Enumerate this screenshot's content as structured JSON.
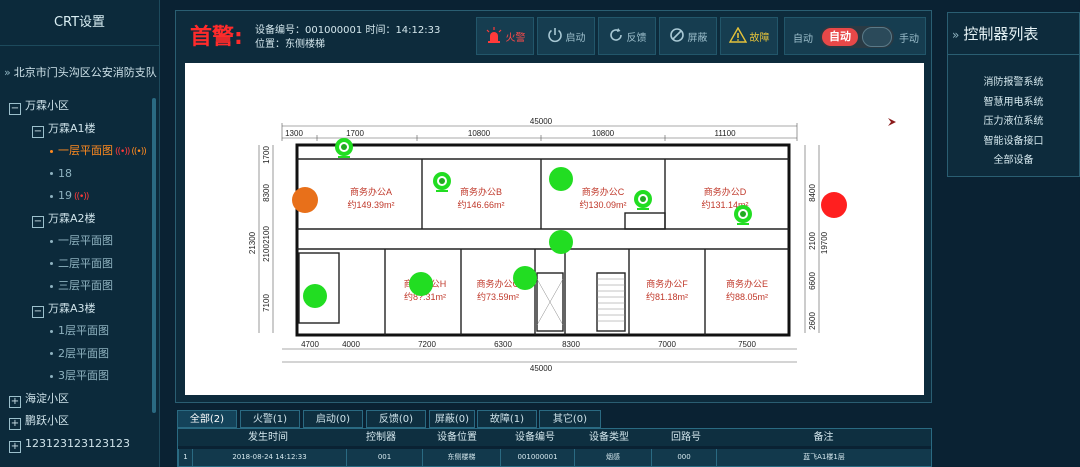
{
  "sidebar": {
    "title": "CRT设置",
    "org": "北京市门头沟区公安消防支队",
    "tree": [
      {
        "kind": "group",
        "label": "万霖小区",
        "expanded": true
      },
      {
        "kind": "group",
        "label": "万霖A1楼",
        "expanded": true
      },
      {
        "kind": "leaf",
        "label": "一层平面图",
        "active": true,
        "alarm": true
      },
      {
        "kind": "leaf",
        "label": "18"
      },
      {
        "kind": "leaf",
        "label": "19",
        "alarm": true
      },
      {
        "kind": "group",
        "label": "万霖A2楼",
        "expanded": true
      },
      {
        "kind": "leaf",
        "label": "一层平面图"
      },
      {
        "kind": "leaf",
        "label": "二层平面图"
      },
      {
        "kind": "leaf",
        "label": "三层平面图"
      },
      {
        "kind": "group",
        "label": "万霖A3楼",
        "expanded": true
      },
      {
        "kind": "leaf",
        "label": "1层平面图"
      },
      {
        "kind": "leaf",
        "label": "2层平面图"
      },
      {
        "kind": "leaf",
        "label": "3层平面图"
      },
      {
        "kind": "group",
        "label": "海淀小区",
        "expanded": false
      },
      {
        "kind": "group",
        "label": "鹏跃小区",
        "expanded": false
      },
      {
        "kind": "group",
        "label": "123123123123123",
        "expanded": false
      }
    ]
  },
  "header": {
    "alert_title": "首警:",
    "device_line1": "设备编号：001000001 时间：14:12:33",
    "device_line2": "位置：东侧楼梯",
    "buttons": {
      "fire": "火警",
      "start": "启动",
      "feedback": "反馈",
      "shield": "屏蔽",
      "fault": "故障"
    },
    "mode": {
      "auto_label": "自动",
      "toggle_label": "自动",
      "manual_label": "手动",
      "state": "auto"
    }
  },
  "floorplan": {
    "dims_top": [
      "45000",
      "1300",
      "1700",
      "10800",
      "10800",
      "11100"
    ],
    "dims_bottom": [
      "4700",
      "4000",
      "7200",
      "6300",
      "8300",
      "7000",
      "7500",
      "45000"
    ],
    "dims_left": [
      "1700",
      "8300",
      "2100",
      "2100",
      "21300",
      "7100"
    ],
    "dims_right": [
      "8400",
      "2100",
      "6600",
      "19700",
      "2600"
    ],
    "rooms": [
      {
        "name": "商务办公A",
        "area": "约149.39m²"
      },
      {
        "name": "商务办公B",
        "area": "约146.66m²"
      },
      {
        "name": "商务办公C",
        "area": "约130.09m²"
      },
      {
        "name": "商务办公D",
        "area": "约131.14m²"
      },
      {
        "name": "商务办公H",
        "area": "约8?.31m²"
      },
      {
        "name": "商务办公G",
        "area": "约73.59m²"
      },
      {
        "name": "商务办公F",
        "area": "约81.18m²"
      },
      {
        "name": "商务办公E",
        "area": "约88.05m²"
      }
    ],
    "colors": {
      "normal": "#22dd22",
      "fire": "#ff1f1f",
      "warning": "#e8701a",
      "camera": "#22dd22"
    }
  },
  "right_panel": {
    "title": "控制器列表",
    "items": [
      "消防报警系统",
      "智慧用电系统",
      "压力液位系统",
      "智能设备接口",
      "全部设备"
    ]
  },
  "tabs": [
    "全部(2)",
    "火警(1)",
    "启动(0)",
    "反馈(0)",
    "屏蔽(0)",
    "故障(1)",
    "其它(0)"
  ],
  "table": {
    "columns": [
      "发生时间",
      "控制器",
      "设备位置",
      "设备编号",
      "设备类型",
      "回路号",
      "备注"
    ],
    "rows": [
      [
        "1",
        "2018-08-24 14:12:33",
        "001",
        "东侧楼梯",
        "001000001",
        "烟感",
        "000",
        "蓝飞A1楼1层"
      ]
    ]
  }
}
